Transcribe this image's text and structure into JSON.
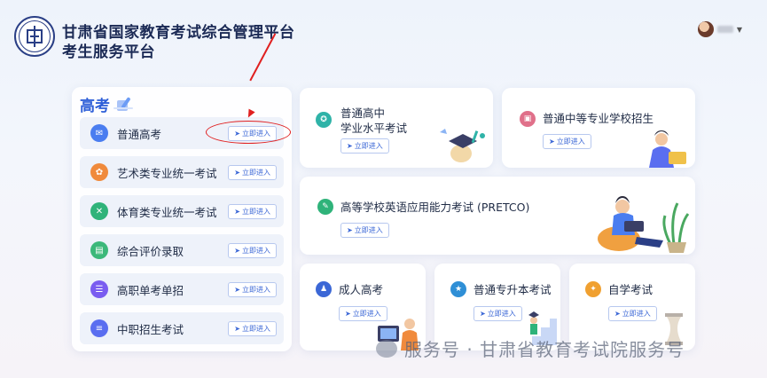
{
  "header": {
    "title_line1": "甘肃省国家教育考试综合管理平台",
    "title_line2": "考生服务平台"
  },
  "enter_label": "立即进入",
  "left_panel": {
    "title": "高考",
    "items": [
      {
        "label": "普通高考",
        "icon": "envelope-icon",
        "color": "#4a7df0"
      },
      {
        "label": "艺术类专业统一考试",
        "icon": "palette-icon",
        "color": "#f08a3c"
      },
      {
        "label": "体育类专业统一考试",
        "icon": "sports-icon",
        "color": "#2fb37a"
      },
      {
        "label": "综合评价录取",
        "icon": "document-icon",
        "color": "#3cb87a"
      },
      {
        "label": "高职单考单招",
        "icon": "form-icon",
        "color": "#7a5cf0"
      },
      {
        "label": "中职招生考试",
        "icon": "list-icon",
        "color": "#5a6ef0"
      }
    ]
  },
  "cards": {
    "putong_gaozhong": {
      "line1": "普通高中",
      "line2": "学业水平考试",
      "icon": "certificate-icon",
      "color": "#2fb3a8"
    },
    "zhongzhuan": {
      "label": "普通中等专业学校招生",
      "icon": "id-card-icon",
      "color": "#e0708a"
    },
    "pretco": {
      "label": "高等学校英语应用能力考试 (PRETCO)",
      "icon": "speech-bubble-icon",
      "color": "#2fb37a"
    },
    "chengren": {
      "label": "成人高考",
      "icon": "person-icon",
      "color": "#3b67d6"
    },
    "zhuanshengben": {
      "label": "普通专升本考试",
      "icon": "star-icon",
      "color": "#2f8fd6"
    },
    "zixue": {
      "label": "自学考试",
      "icon": "bulb-icon",
      "color": "#f0a030"
    }
  },
  "watermark": "服务号 · 甘肃省教育考试院服务号"
}
